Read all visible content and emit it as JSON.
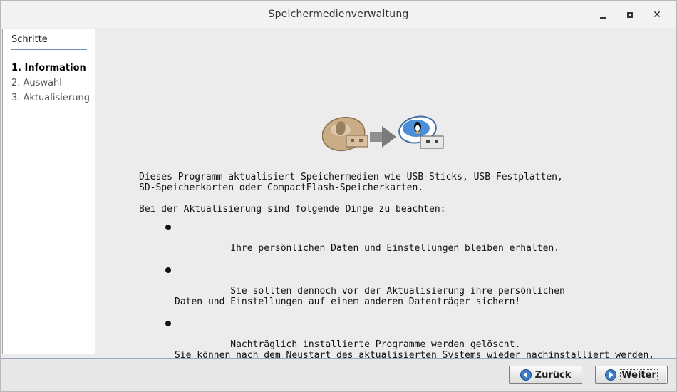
{
  "window": {
    "title": "Speichermedienverwaltung",
    "controls": {
      "minimize_icon": "minimize-icon",
      "maximize_icon": "maximize-icon",
      "close_icon": "close-icon"
    }
  },
  "sidebar": {
    "heading": "Schritte",
    "steps": [
      {
        "label": "1. Information",
        "active": true
      },
      {
        "label": "2. Auswahl",
        "active": false
      },
      {
        "label": "3. Aktualisierung",
        "active": false
      }
    ]
  },
  "main": {
    "illustration": {
      "from_icon": "usb-stick-old-icon",
      "arrow_icon": "arrow-right-icon",
      "to_icon": "usb-stick-new-icon"
    },
    "intro": "Dieses Programm aktualisiert Speichermedien wie USB-Sticks, USB-Festplatten,\nSD-Speicherkarten oder CompactFlash-Speicherkarten.",
    "notice_heading": "Bei der Aktualisierung sind folgende Dinge zu beachten:",
    "bullets": [
      "Ihre persönlichen Daten und Einstellungen bleiben erhalten.",
      "Sie sollten dennoch vor der Aktualisierung ihre persönlichen\nDaten und Einstellungen auf einem anderen Datenträger sichern!",
      "Nachträglich installierte Programme werden gelöscht.\nSie können nach dem Neustart des aktualisierten Systems wieder nachinstalliert werden."
    ]
  },
  "footer": {
    "back_label": "Zurück",
    "next_label": "Weiter",
    "back_icon": "arrow-left-icon",
    "next_icon": "arrow-right-icon"
  },
  "colors": {
    "accent": "#3d7cc9",
    "sidebar_rule": "#6a8ab0"
  }
}
